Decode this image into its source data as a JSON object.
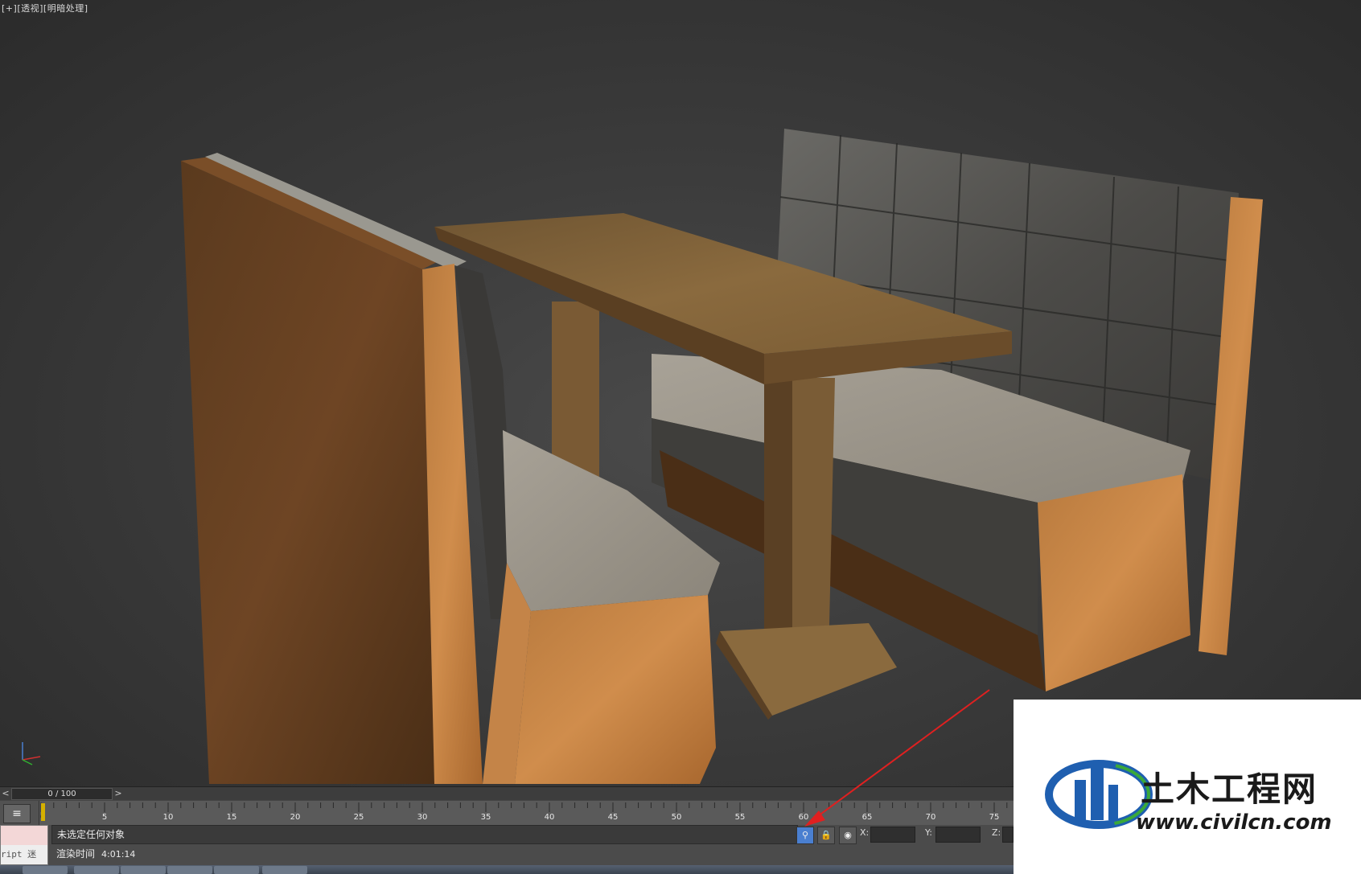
{
  "viewport": {
    "label_plus": "[+]",
    "label_view": "[透视]",
    "label_shading": "[明暗处理]"
  },
  "timeline": {
    "frame_display": "0 / 100",
    "prev_label": "<",
    "next_label": ">",
    "current_frame_label": "0",
    "ticks": [
      "5",
      "10",
      "15",
      "20",
      "25",
      "30",
      "35",
      "40",
      "45",
      "50",
      "55",
      "60",
      "65",
      "70",
      "75"
    ]
  },
  "status": {
    "listener_script": "ript 迷",
    "prompt_text": "未选定任何对象",
    "render_time_label": "渲染时间",
    "render_time_value": "4:01:14",
    "x_label": "X:",
    "y_label": "Y:",
    "z_label": "Z:"
  },
  "watermark": {
    "title": "土木工程网",
    "url": "www.civilcn.com"
  },
  "colors": {
    "accent_blue": "#4a7fd0",
    "arrow_red": "#e02020",
    "frame_marker": "#d4b000"
  }
}
